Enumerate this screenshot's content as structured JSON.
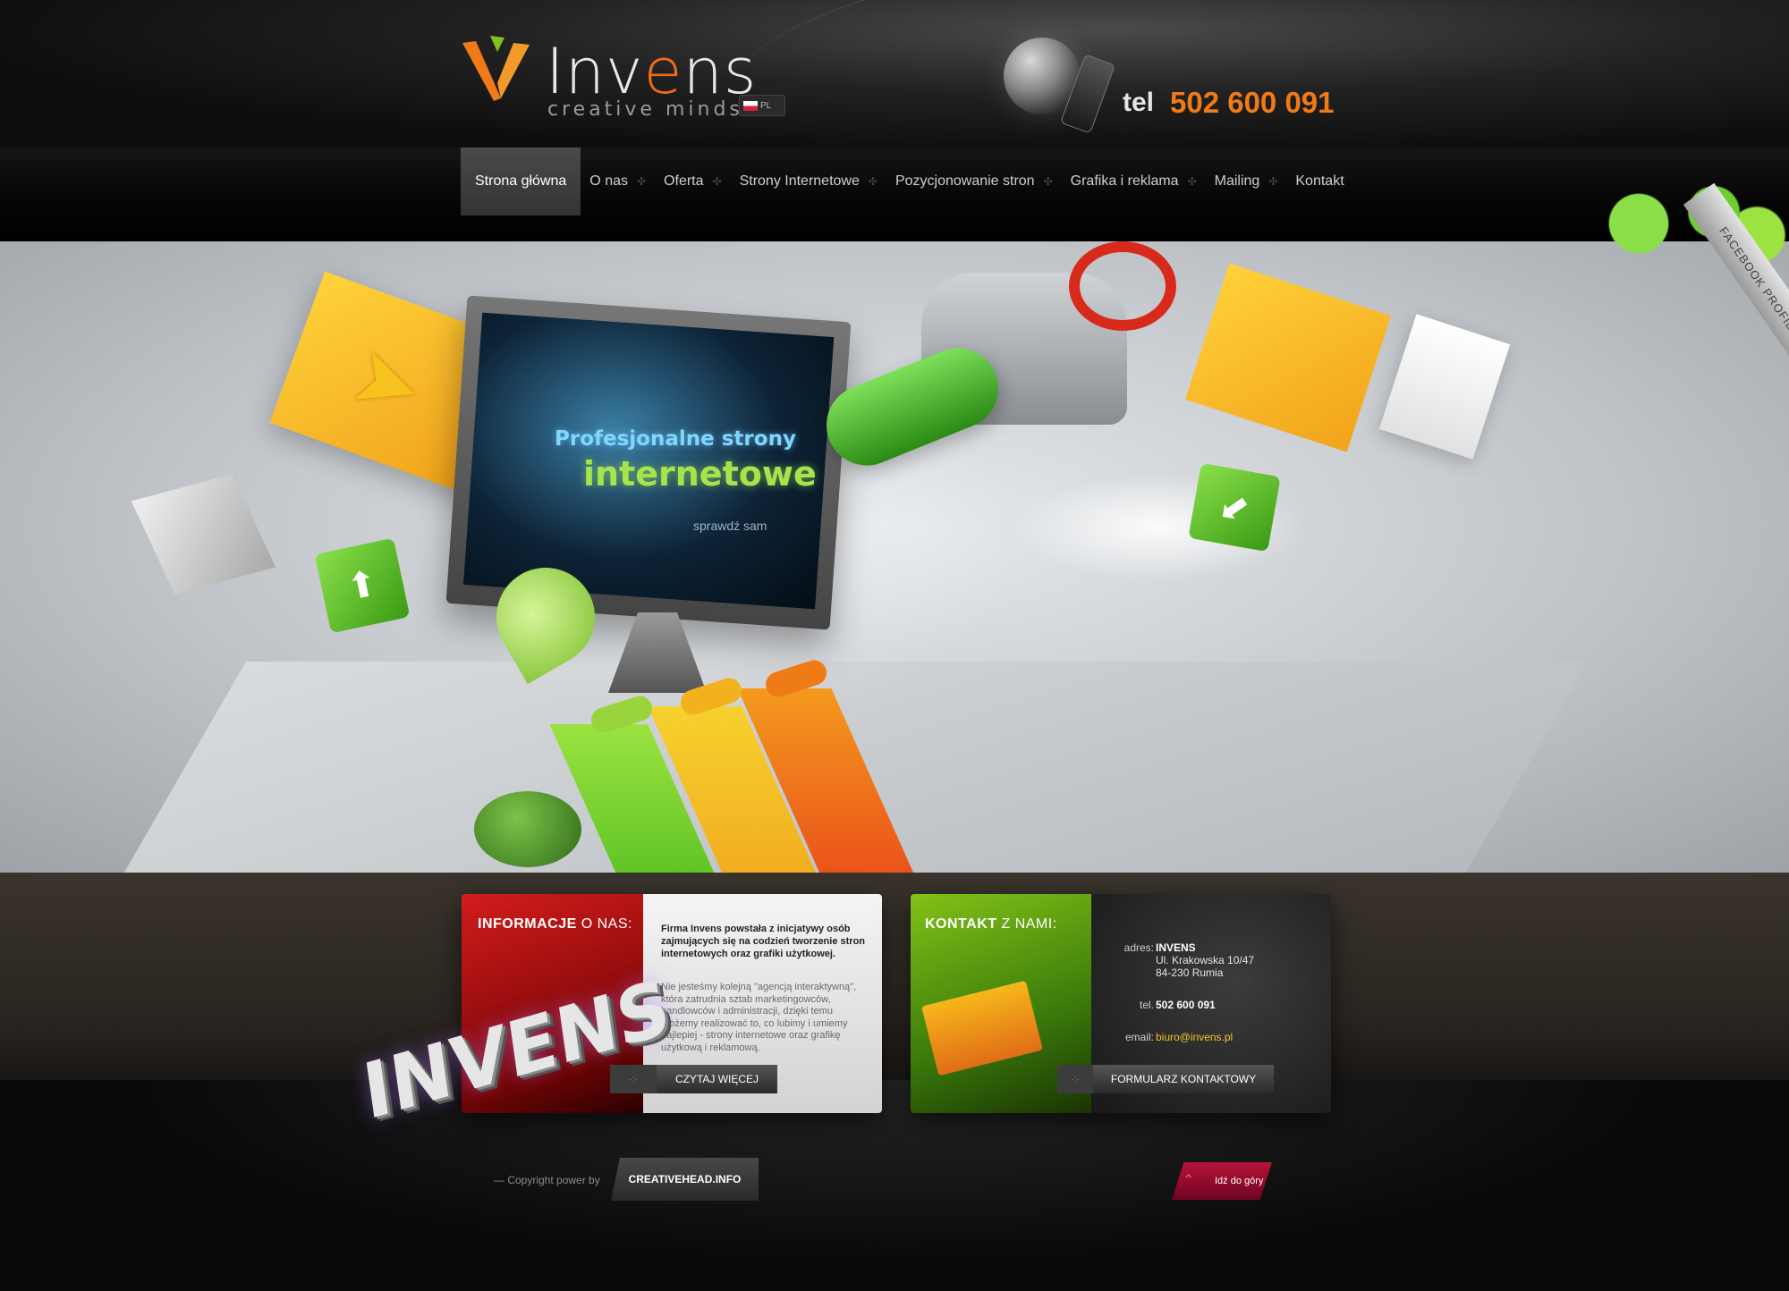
{
  "brand": {
    "name_prefix": "Inv",
    "name_e": "e",
    "name_suffix": "ns",
    "tagline": "creative minds",
    "lang_code": "PL"
  },
  "contact_header": {
    "tel_label": "tel",
    "tel_number": "502 600 091"
  },
  "nav": {
    "items": [
      {
        "label": "Strona główna",
        "active": true
      },
      {
        "label": "O nas"
      },
      {
        "label": "Oferta"
      },
      {
        "label": "Strony Internetowe"
      },
      {
        "label": "Pozycjonowanie stron"
      },
      {
        "label": "Grafika i reklama"
      },
      {
        "label": "Mailing"
      },
      {
        "label": "Kontakt"
      }
    ],
    "separator": "✣"
  },
  "hero": {
    "line1": "Profesjonalne strony",
    "line2": "internetowe",
    "cta": "sprawdź sam"
  },
  "facebook": {
    "label": "FACEBOOK PROFIL"
  },
  "info_box": {
    "title_bold": "INFORMACJE",
    "title_thin": "O NAS:",
    "intro": "Firma Invens powstała z inicjatywy osób zajmujących się na codzień tworzenie stron internetowych oraz grafiki użytkowej.",
    "body": "Nie jesteśmy kolejną \"agencją interaktywną\", która zatrudnia sztab marketingowców, handlowców i administracji, dzięki temu możemy realizować to, co lubimy i umiemy najlepiej - strony internetowe oraz grafikę użytkową i reklamową.",
    "button": "CZYTAJ WIĘCEJ",
    "handle": "·:·"
  },
  "contact_box": {
    "title_bold": "KONTAKT",
    "title_thin": "Z NAMI:",
    "address_label": "adres:",
    "company": "INVENS",
    "street": "Ul. Krakowska 10/47",
    "city": "84-230 Rumia",
    "tel_label": "tel.",
    "tel": "502 600 091",
    "email_label": "email:",
    "email": "biuro@invens.pl",
    "button": "FORMULARZ KONTAKTOWY",
    "handle": "·:·"
  },
  "decor": {
    "invens_3d": "INVENS"
  },
  "footer": {
    "copyright": "— Copyright power by",
    "credit": "CREATIVEHEAD.INFO",
    "to_top": "Idź do góry",
    "to_top_icon": "⌃"
  },
  "colors": {
    "accent_orange": "#f07a17",
    "accent_green": "#a7e34b",
    "accent_red": "#d31c1c",
    "email_yellow": "#f2c72a"
  }
}
